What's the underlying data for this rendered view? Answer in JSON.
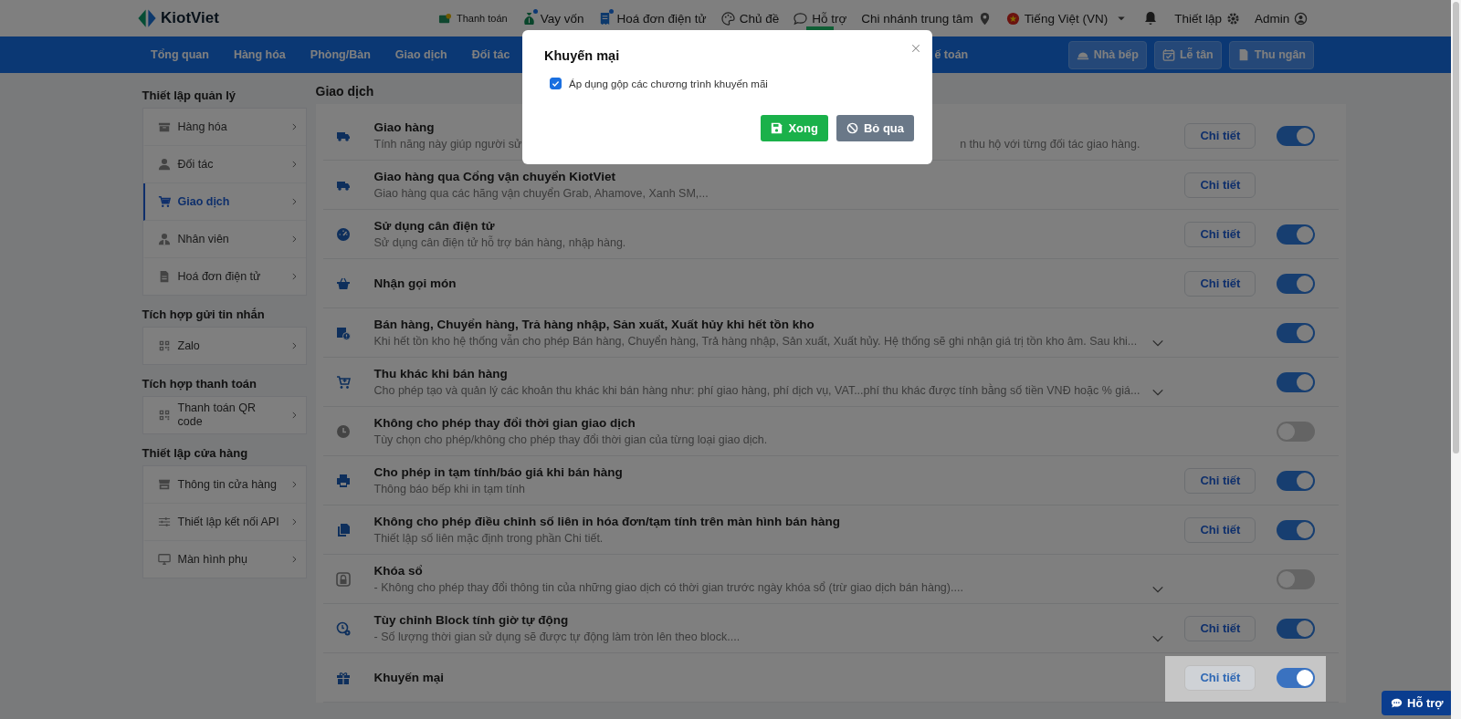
{
  "header": {
    "logo": "KiotViet",
    "items": [
      {
        "label": "Thanh toán",
        "notification": false,
        "highlighted": false
      },
      {
        "label": "Vay vốn",
        "notification": true,
        "highlighted": false
      },
      {
        "label": "Hoá đơn điện tử",
        "notification": true,
        "highlighted": false
      },
      {
        "label": "Chủ đề",
        "notification": false,
        "highlighted": false
      },
      {
        "label": "Hỗ trợ",
        "notification": false,
        "highlighted": true
      },
      {
        "label": "Chi nhánh trung tâm",
        "notification": false,
        "highlighted": false
      },
      {
        "label": "Tiếng Việt (VN)",
        "notification": false,
        "highlighted": false
      }
    ],
    "settings": "Thiết lập",
    "user": "Admin"
  },
  "nav": {
    "items": [
      "Tổng quan",
      "Hàng hóa",
      "Phòng/Bàn",
      "Giao dịch",
      "Đối tác"
    ],
    "partial_item": "ế toán",
    "buttons": [
      "Nhà bếp",
      "Lễ tân",
      "Thu ngân"
    ]
  },
  "sidebar": {
    "sections": [
      {
        "title": "Thiết lập quản lý",
        "items": [
          {
            "label": "Hàng hóa",
            "selected": false
          },
          {
            "label": "Đối tác",
            "selected": false
          },
          {
            "label": "Giao dịch",
            "selected": true
          },
          {
            "label": "Nhân viên",
            "selected": false
          },
          {
            "label": "Hoá đơn điện tử",
            "selected": false
          }
        ]
      },
      {
        "title": "Tích hợp gửi tin nhắn",
        "items": [
          {
            "label": "Zalo",
            "selected": false
          }
        ]
      },
      {
        "title": "Tích hợp thanh toán",
        "items": [
          {
            "label": "Thanh toán QR code",
            "selected": false
          }
        ]
      },
      {
        "title": "Thiết lập cửa hàng",
        "items": [
          {
            "label": "Thông tin cửa hàng",
            "selected": false
          },
          {
            "label": "Thiết lập kết nối API",
            "selected": false
          },
          {
            "label": "Màn hình phụ",
            "selected": false
          }
        ]
      }
    ]
  },
  "main": {
    "title": "Giao dịch",
    "rows": [
      {
        "title": "Giao hàng",
        "description": [
          "Tính năng này giúp người sử",
          "n thu hộ với từng đối tác giao hàng."
        ],
        "expandable": false,
        "detail": "Chi tiết",
        "on": true,
        "highlighted": false
      },
      {
        "title": "Giao hàng qua Cổng vận chuyển KiotViet",
        "description": [
          "Giao hàng qua các hãng vận chuyển Grab, Ahamove, Xanh SM,..."
        ],
        "expandable": false,
        "detail": "Chi tiết",
        "highlighted": false
      },
      {
        "title": "Sử dụng cân điện tử",
        "description": [
          "Sử dụng cân điện tử hỗ trợ bán hàng, nhập hàng."
        ],
        "expandable": false,
        "detail": "Chi tiết",
        "on": true,
        "highlighted": false
      },
      {
        "title": "Nhận gọi món",
        "expandable": false,
        "detail": "Chi tiết",
        "on": true,
        "highlighted": false
      },
      {
        "title": "Bán hàng, Chuyển hàng, Trả hàng nhập, Sản xuất, Xuất hủy khi hết tồn kho",
        "description": [
          "Khi hết tồn kho hệ thống vẫn cho phép Bán hàng, Chuyển hàng, Trả hàng nhập, Sản xuất, Xuất hủy. Hệ thống sẽ ghi nhận giá trị tồn kho âm. Sau khi..."
        ],
        "expandable": true,
        "on": true,
        "highlighted": false
      },
      {
        "title": "Thu khác khi bán hàng",
        "description": [
          "Cho phép tạo và quản lý các khoản thu khác khi bán hàng như: phí giao hàng, phí dịch vụ, VAT...phí thu khác được tính bằng số tiền VNĐ hoặc % giá..."
        ],
        "expandable": true,
        "on": true,
        "highlighted": false
      },
      {
        "title": "Không cho phép thay đổi thời gian giao dịch",
        "description": [
          "Tùy chọn cho phép/không cho phép thay đổi thời gian của từng loại giao dịch."
        ],
        "expandable": false,
        "on": false,
        "highlighted": false
      },
      {
        "title": "Cho phép in tạm tính/báo giá khi bán hàng",
        "description": [
          "Thông báo bếp khi in tạm tính"
        ],
        "expandable": false,
        "detail": "Chi tiết",
        "on": true,
        "highlighted": false
      },
      {
        "title": "Không cho phép điều chỉnh số liên in hóa đơn/tạm tính trên màn hình bán hàng",
        "description": [
          "Thiết lập số liên mặc định trong phần Chi tiết."
        ],
        "expandable": false,
        "detail": "Chi tiết",
        "on": true,
        "highlighted": false
      },
      {
        "title": "Khóa sổ",
        "description": [
          "- Không cho phép thay đổi thông tin của những giao dịch có thời gian trước ngày khóa sổ (trừ giao dịch bán hàng)...."
        ],
        "expandable": true,
        "on": false,
        "highlighted": false
      },
      {
        "title": "Tùy chỉnh Block tính giờ tự động",
        "description": [
          "- Số lượng thời gian sử dụng sẽ được tự động làm tròn lên theo block...."
        ],
        "expandable": true,
        "detail": "Chi tiết",
        "on": true,
        "highlighted": false
      },
      {
        "title": "Khuyến mại",
        "expandable": false,
        "detail": "Chi tiết",
        "on": true,
        "highlighted": true
      }
    ]
  },
  "modal": {
    "title": "Khuyến mại",
    "checkbox": {
      "label": "Áp dụng gộp các chương trình khuyến mãi",
      "checked": true
    },
    "buttons": [
      {
        "label": "Xong",
        "kind": "primary"
      },
      {
        "label": "Bỏ qua",
        "kind": "secondary"
      }
    ]
  },
  "help_button": "Hỗ trợ"
}
